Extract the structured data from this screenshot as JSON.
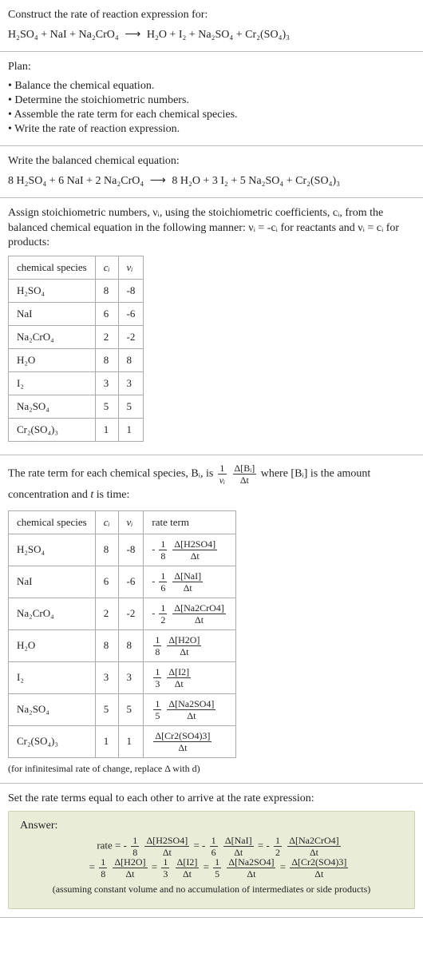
{
  "s1": {
    "title": "Construct the rate of reaction expression for:",
    "eq_lhs": "H₂SO₄ + NaI + Na₂CrO₄",
    "arrow": "⟶",
    "eq_rhs": "H₂O + I₂ + Na₂SO₄ + Cr₂(SO₄)₃"
  },
  "s2": {
    "title": "Plan:",
    "b1": "Balance the chemical equation.",
    "b2": "Determine the stoichiometric numbers.",
    "b3": "Assemble the rate term for each chemical species.",
    "b4": "Write the rate of reaction expression."
  },
  "s3": {
    "title": "Write the balanced chemical equation:",
    "eq_lhs": "8 H₂SO₄ + 6 NaI + 2 Na₂CrO₄",
    "arrow": "⟶",
    "eq_rhs": "8 H₂O + 3 I₂ + 5 Na₂SO₄ + Cr₂(SO₄)₃"
  },
  "s4": {
    "para_a": "Assign stoichiometric numbers, νᵢ, using the stoichiometric coefficients, cᵢ, from the balanced chemical equation in the following manner: νᵢ = -cᵢ for reactants and νᵢ = cᵢ for products:",
    "h1": "chemical species",
    "h2": "cᵢ",
    "h3": "νᵢ",
    "h4": "rate term",
    "rows": [
      {
        "sp": "H₂SO₄",
        "c": "8",
        "v": "-8"
      },
      {
        "sp": "NaI",
        "c": "6",
        "v": "-6"
      },
      {
        "sp": "Na₂CrO₄",
        "c": "2",
        "v": "-2"
      },
      {
        "sp": "H₂O",
        "c": "8",
        "v": "8"
      },
      {
        "sp": "I₂",
        "c": "3",
        "v": "3"
      },
      {
        "sp": "Na₂SO₄",
        "c": "5",
        "v": "5"
      },
      {
        "sp": "Cr₂(SO₄)₃",
        "c": "1",
        "v": "1"
      }
    ]
  },
  "s5": {
    "pre": "The rate term for each chemical species, Bᵢ, is ",
    "one": "1",
    "nu": "νᵢ",
    "dBi": "Δ[Bᵢ]",
    "dt": "Δt",
    "post1": " where [Bᵢ] is the amount",
    "post2": "concentration and ",
    "tvar": "t",
    "post3": " is time:",
    "rows": [
      {
        "sp": "H₂SO₄",
        "c": "8",
        "v": "-8",
        "neg": "-",
        "fd": "8",
        "num": "Δ[H2SO4]",
        "den": "Δt"
      },
      {
        "sp": "NaI",
        "c": "6",
        "v": "-6",
        "neg": "-",
        "fd": "6",
        "num": "Δ[NaI]",
        "den": "Δt"
      },
      {
        "sp": "Na₂CrO₄",
        "c": "2",
        "v": "-2",
        "neg": "-",
        "fd": "2",
        "num": "Δ[Na2CrO4]",
        "den": "Δt"
      },
      {
        "sp": "H₂O",
        "c": "8",
        "v": "8",
        "neg": "",
        "fd": "8",
        "num": "Δ[H2O]",
        "den": "Δt"
      },
      {
        "sp": "I₂",
        "c": "3",
        "v": "3",
        "neg": "",
        "fd": "3",
        "num": "Δ[I2]",
        "den": "Δt"
      },
      {
        "sp": "Na₂SO₄",
        "c": "5",
        "v": "5",
        "neg": "",
        "fd": "5",
        "num": "Δ[Na2SO4]",
        "den": "Δt"
      },
      {
        "sp": "Cr₂(SO₄)₃",
        "c": "1",
        "v": "1",
        "neg": "",
        "fd": "",
        "num": "Δ[Cr2(SO4)3]",
        "den": "Δt"
      }
    ],
    "note": "(for infinitesimal rate of change, replace Δ with d)"
  },
  "s6": {
    "title": "Set the rate terms equal to each other to arrive at the rate expression:",
    "ans_label": "Answer:",
    "rate": "rate = ",
    "t1_neg": "-",
    "t1_fd": "8",
    "t1_num": "Δ[H2SO4]",
    "t1_den": "Δt",
    "t2_neg": "-",
    "t2_fd": "6",
    "t2_num": "Δ[NaI]",
    "t2_den": "Δt",
    "t3_neg": "-",
    "t3_fd": "2",
    "t3_num": "Δ[Na2CrO4]",
    "t3_den": "Δt",
    "t4_fd": "8",
    "t4_num": "Δ[H2O]",
    "t4_den": "Δt",
    "t5_fd": "3",
    "t5_num": "Δ[I2]",
    "t5_den": "Δt",
    "t6_fd": "5",
    "t6_num": "Δ[Na2SO4]",
    "t6_den": "Δt",
    "t7_num": "Δ[Cr2(SO4)3]",
    "t7_den": "Δt",
    "eq": " = ",
    "one": "1",
    "assume": "(assuming constant volume and no accumulation of intermediates or side products)"
  },
  "chart_data": {
    "type": "table",
    "title": "Stoichiometric coefficients and numbers",
    "columns": [
      "chemical species",
      "c_i",
      "ν_i"
    ],
    "rows": [
      [
        "H2SO4",
        8,
        -8
      ],
      [
        "NaI",
        6,
        -6
      ],
      [
        "Na2CrO4",
        2,
        -2
      ],
      [
        "H2O",
        8,
        8
      ],
      [
        "I2",
        3,
        3
      ],
      [
        "Na2SO4",
        5,
        5
      ],
      [
        "Cr2(SO4)3",
        1,
        1
      ]
    ]
  }
}
